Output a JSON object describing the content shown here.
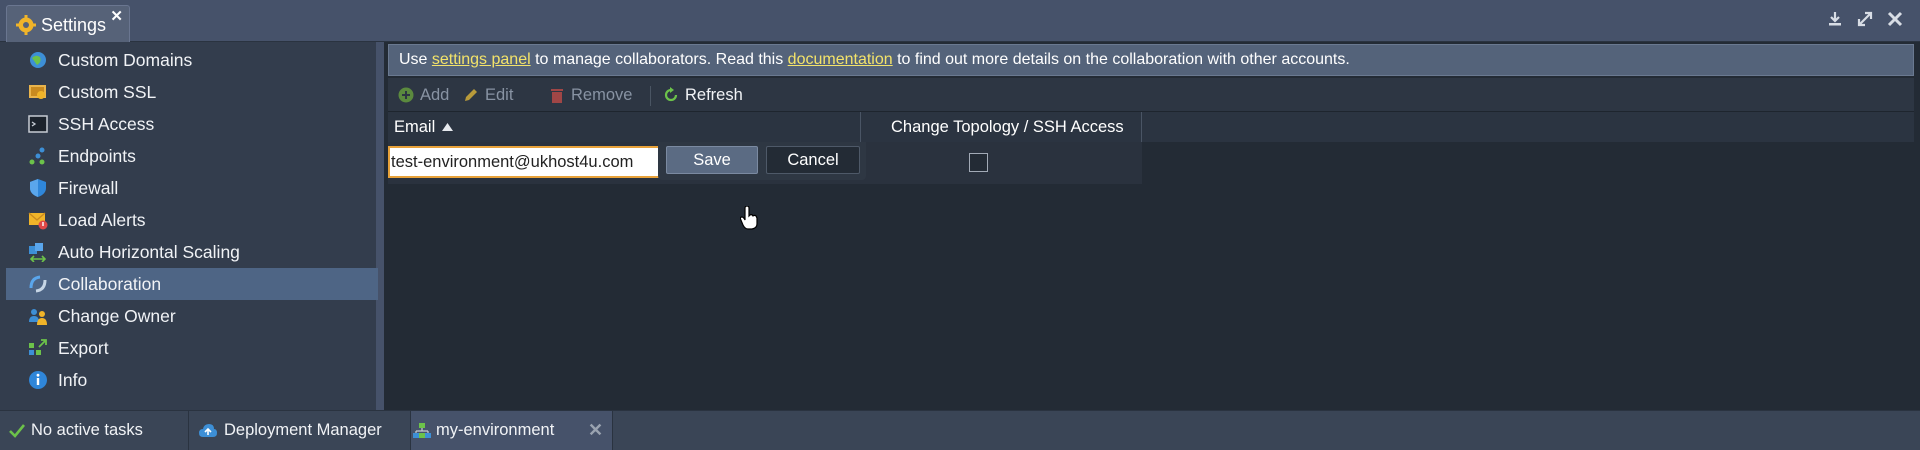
{
  "window": {
    "tab_title": "Settings",
    "tab_close": "✕"
  },
  "sidebar": {
    "items": [
      {
        "label": "Custom Domains",
        "icon": "globe-icon"
      },
      {
        "label": "Custom SSL",
        "icon": "certificate-icon"
      },
      {
        "label": "SSH Access",
        "icon": "terminal-icon"
      },
      {
        "label": "Endpoints",
        "icon": "endpoints-icon"
      },
      {
        "label": "Firewall",
        "icon": "shield-icon"
      },
      {
        "label": "Load Alerts",
        "icon": "alert-mail-icon"
      },
      {
        "label": "Auto Horizontal Scaling",
        "icon": "scaling-icon"
      },
      {
        "label": "Collaboration",
        "icon": "collaboration-icon",
        "active": true
      },
      {
        "label": "Change Owner",
        "icon": "change-owner-icon"
      },
      {
        "label": "Export",
        "icon": "export-icon"
      },
      {
        "label": "Info",
        "icon": "info-icon"
      }
    ]
  },
  "info": {
    "pre": "Use ",
    "link1": "settings panel",
    "mid": " to manage collaborators. Read this ",
    "link2": "documentation",
    "post": " to find out more details on the collaboration with other accounts."
  },
  "toolbar": {
    "add": "Add",
    "edit": "Edit",
    "remove": "Remove",
    "refresh": "Refresh"
  },
  "grid": {
    "columns": [
      "Email",
      "Change Topology / SSH Access"
    ],
    "sort": "ascending",
    "row": {
      "email_value": "test-environment@ukhost4u.com",
      "change_topology_checked": false
    }
  },
  "editor": {
    "save": "Save",
    "cancel": "Cancel"
  },
  "statusbar": {
    "tasks": "No active tasks",
    "deployment": "Deployment Manager",
    "environment": "my-environment",
    "close": "✕"
  },
  "colors": {
    "accent_link": "#f3e36a",
    "active_item": "#4e6585",
    "focus_border": "#e8a23a",
    "gear": "#f0b429",
    "success": "#6cc24a"
  }
}
